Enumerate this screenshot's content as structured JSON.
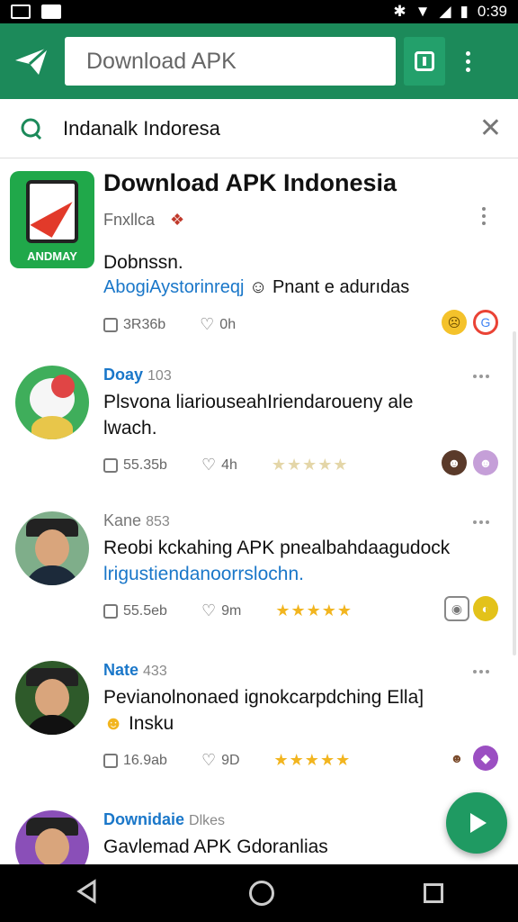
{
  "status_bar": {
    "time": "0:39"
  },
  "app_bar": {
    "search_text": "Download APK"
  },
  "query_bar": {
    "query": "Indanalk Indoresa"
  },
  "top_card": {
    "title": "Download APK Indonesia",
    "subtitle": "Fnxllca",
    "icon_brand": "ANDMAY",
    "line1": "Dobnssn.",
    "line2_link": "AbogiAystorinreqj",
    "line2_rest": "Pnant e adurıdas",
    "likes": "3R36b",
    "hearts": "0h"
  },
  "posts": [
    {
      "name": "Doay",
      "count": "103",
      "text": "Plsvona liariouseahIriendaroueny ale",
      "text2": "lwach.",
      "likes": "55.35b",
      "hearts": "4h",
      "rating": 5,
      "rating_faded": true
    },
    {
      "name": "Kane",
      "count": "853",
      "text": "Reobi kckahing APK pnealbahdaagudock",
      "text2_link": "lrigustiendanoorrslochn.",
      "likes": "55.5eb",
      "hearts": "9m",
      "rating": 5,
      "rating_faded": false
    },
    {
      "name": "Nate",
      "count": "433",
      "text": "Pevianolnonaed ignokcarpdching Ella]",
      "text2": "Insku",
      "likes": "16.9ab",
      "hearts": "9D",
      "rating": 5,
      "rating_faded": false
    },
    {
      "name": "Downidaie",
      "count": "Dlkes",
      "text": "Gavlemad APK Gdoranlias"
    }
  ],
  "colors": {
    "brand": "#1c8a5a",
    "accent": "#1a77c9",
    "star": "#f2b51f"
  }
}
